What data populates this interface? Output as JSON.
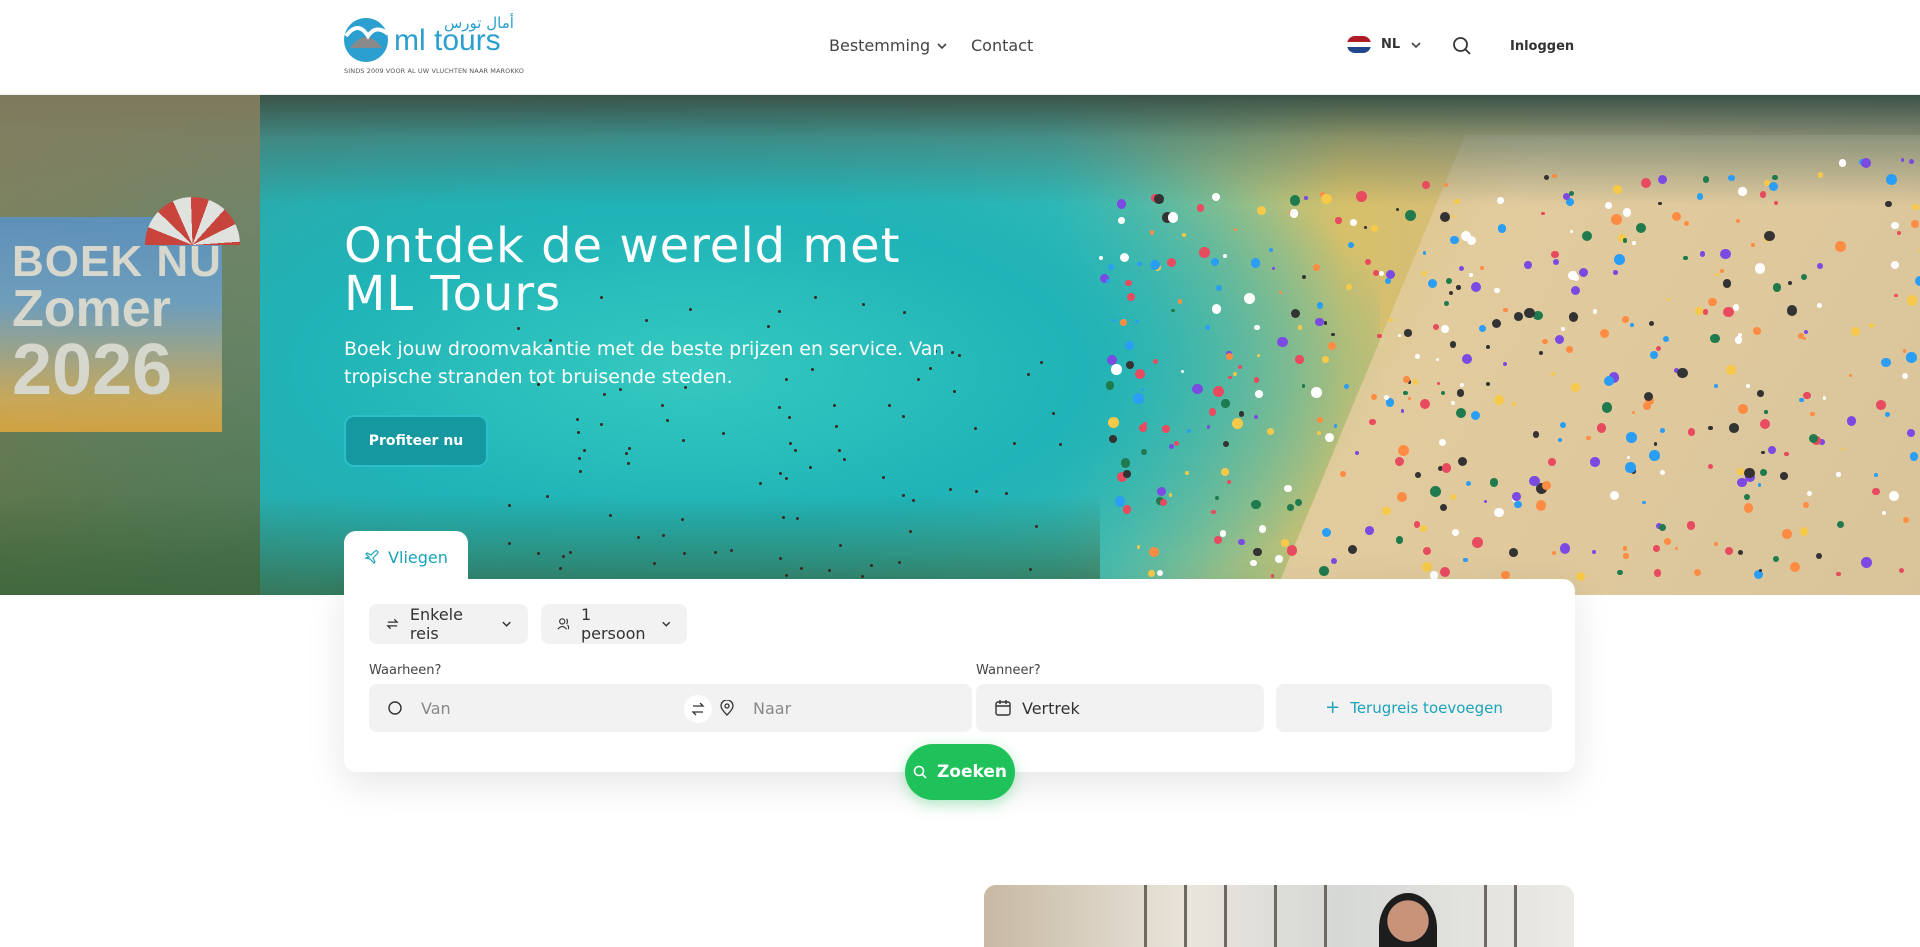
{
  "header": {
    "logo": {
      "brand": "ml tours",
      "arabic": "أمال تورس",
      "tagline": "SINDS 2009 VOOR AL UW VLUCHTEN NAAR MAROKKO"
    },
    "nav": [
      {
        "label": "Bestemming",
        "icon": "chevron-down-icon"
      },
      {
        "label": "Contact"
      }
    ],
    "language": {
      "code": "NL",
      "flag_colors": [
        "#ae1c28",
        "#ffffff",
        "#21468b"
      ]
    },
    "search_icon": "search-icon",
    "login_label": "Inloggen"
  },
  "hero": {
    "promo": {
      "line1": "BOEK NU",
      "line2": "Zomer",
      "line3": "2026"
    },
    "title": "Ontdek de wereld met ML Tours",
    "subtitle": "Boek jouw droomvakantie met de beste prijzen en service. Van tropische stranden tot bruisende steden.",
    "cta_label": "Profiteer nu"
  },
  "search": {
    "tab_label": "Vliegen",
    "trip_type": "Enkele reis",
    "passengers": "1 persoon",
    "where_label": "Waarheen?",
    "from_placeholder": "Van",
    "to_placeholder": "Naar",
    "when_label": "Wanneer?",
    "departure_placeholder": "Vertrek",
    "return_label": "Terugreis toevoegen",
    "submit_label": "Zoeken"
  },
  "colors": {
    "accent": "#1ba3b8",
    "cta_bg": "#15989f",
    "search_button": "#1fc25a"
  }
}
